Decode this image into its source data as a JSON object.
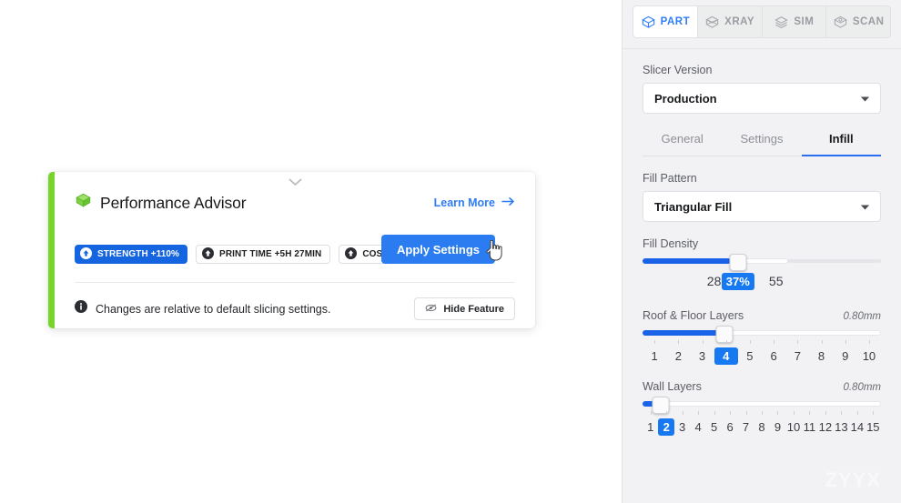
{
  "advisor": {
    "title": "Performance Advisor",
    "icon": "green-cube-icon",
    "collapse_icon": "chevron-down-icon",
    "learn_more": "Learn More",
    "learn_more_icon": "arrow-right-icon",
    "metrics": [
      {
        "label": "STRENGTH +110%",
        "style": "primary",
        "icon": "arrow-up-circle-icon"
      },
      {
        "label": "PRINT TIME +5H 27MIN",
        "style": "plain",
        "icon": "arrow-up-circle-icon"
      },
      {
        "label": "COST +$11.01",
        "style": "plain",
        "icon": "arrow-up-circle-icon"
      }
    ],
    "apply_button": "Apply Settings",
    "footer_note": "Changes are relative to default slicing settings.",
    "footer_icon": "info-icon",
    "hide_feature": "Hide Feature",
    "hide_feature_icon": "eye-off-icon",
    "accent_color": "#76d42b"
  },
  "panel": {
    "mode_tabs": [
      {
        "label": "PART",
        "icon": "cube-outline-icon",
        "active": true
      },
      {
        "label": "XRAY",
        "icon": "cube-xray-icon",
        "active": false
      },
      {
        "label": "SIM",
        "icon": "cube-layers-icon",
        "active": false
      },
      {
        "label": "SCAN",
        "icon": "cube-scan-icon",
        "active": false
      }
    ],
    "slicer_version": {
      "label": "Slicer Version",
      "value": "Production",
      "caret_icon": "caret-down-icon"
    },
    "sub_tabs": [
      {
        "label": "General",
        "active": false
      },
      {
        "label": "Settings",
        "active": false
      },
      {
        "label": "Infill",
        "active": true
      }
    ],
    "fill_pattern": {
      "label": "Fill Pattern",
      "value": "Triangular Fill",
      "caret_icon": "caret-down-icon"
    },
    "fill_density": {
      "label": "Fill Density",
      "value": "37%",
      "left_tick": "28",
      "right_tick": "55",
      "fill_percent": 37,
      "thumb_percent": 40,
      "white_segment_end_percent": 61
    },
    "roof_floor_layers": {
      "label": "Roof & Floor Layers",
      "value_mm": "0.80mm",
      "selected": 4,
      "scale": [
        1,
        2,
        3,
        4,
        5,
        6,
        7,
        8,
        9,
        10
      ],
      "fill_percent": 34
    },
    "wall_layers": {
      "label": "Wall Layers",
      "value_mm": "0.80mm",
      "selected": 2,
      "scale": [
        1,
        2,
        3,
        4,
        5,
        6,
        7,
        8,
        9,
        10,
        11,
        12,
        13,
        14,
        15
      ],
      "fill_percent": 6
    },
    "accent_color": "#1779f2",
    "background": "#f2f2f4"
  },
  "watermark": "ZYYX"
}
